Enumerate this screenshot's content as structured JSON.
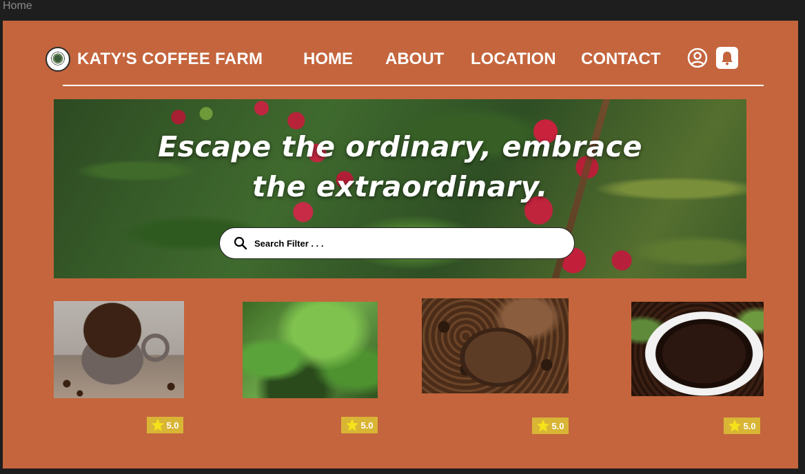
{
  "window": {
    "title": "Home"
  },
  "header": {
    "brand": "KATY'S COFFEE FARM",
    "nav": [
      "HOME",
      "ABOUT",
      "LOCATION",
      "CONTACT"
    ]
  },
  "hero": {
    "headline_line1": "Escape the ordinary, embrace",
    "headline_line2": "the extraordinary.",
    "search_placeholder": "Search Filter . . ."
  },
  "products": [
    {
      "image": "coffee-cup-with-beans",
      "rating": "5.0"
    },
    {
      "image": "coffee-seedlings",
      "rating": "5.0"
    },
    {
      "image": "coffee-beans-in-wooden-bowls",
      "rating": "5.0"
    },
    {
      "image": "roasted-beans-in-white-bowl",
      "rating": "5.0"
    }
  ],
  "colors": {
    "page_background": "#c4653d",
    "rating_badge": "#d9b536",
    "text": "#ffffff"
  },
  "icons": [
    "logo",
    "user-icon",
    "bell-icon",
    "search-icon",
    "star-icon"
  ]
}
